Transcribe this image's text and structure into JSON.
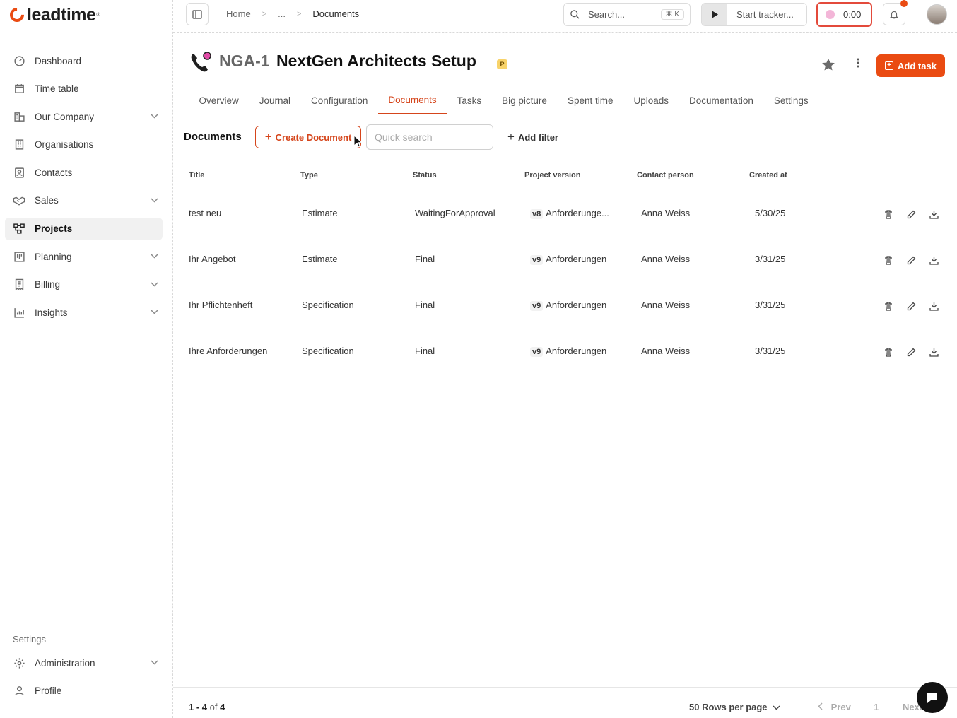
{
  "brand": {
    "name": "leadtime",
    "mark": "®",
    "accent": "#ea4b12"
  },
  "sidebar": {
    "items": [
      {
        "label": "Dashboard",
        "icon": "dashboard-icon",
        "expandable": false
      },
      {
        "label": "Time table",
        "icon": "calendar-icon",
        "expandable": false
      },
      {
        "label": "Our Company",
        "icon": "company-icon",
        "expandable": true
      },
      {
        "label": "Organisations",
        "icon": "building-icon",
        "expandable": false
      },
      {
        "label": "Contacts",
        "icon": "contact-card-icon",
        "expandable": false
      },
      {
        "label": "Sales",
        "icon": "handshake-icon",
        "expandable": true
      },
      {
        "label": "Projects",
        "icon": "projects-icon",
        "expandable": false,
        "active": true
      },
      {
        "label": "Planning",
        "icon": "planning-icon",
        "expandable": true
      },
      {
        "label": "Billing",
        "icon": "billing-icon",
        "expandable": true
      },
      {
        "label": "Insights",
        "icon": "chart-icon",
        "expandable": true
      }
    ],
    "settings_label": "Settings",
    "bottom_items": [
      {
        "label": "Administration",
        "icon": "gear-icon",
        "expandable": true
      },
      {
        "label": "Profile",
        "icon": "user-icon",
        "expandable": false
      }
    ]
  },
  "topbar": {
    "breadcrumb": [
      "Home",
      "...",
      "Documents"
    ],
    "search_label": "Search...",
    "search_shortcut": "⌘ K",
    "tracker_label": "Start tracker...",
    "timer_value": "0:00"
  },
  "project": {
    "key": "NGA-1",
    "name": "NextGen Architects Setup",
    "badge": "P",
    "add_task_label": "Add task"
  },
  "tabs": [
    {
      "label": "Overview"
    },
    {
      "label": "Journal"
    },
    {
      "label": "Configuration"
    },
    {
      "label": "Documents",
      "active": true
    },
    {
      "label": "Tasks"
    },
    {
      "label": "Big picture"
    },
    {
      "label": "Spent time"
    },
    {
      "label": "Uploads"
    },
    {
      "label": "Documentation"
    },
    {
      "label": "Settings"
    }
  ],
  "documents": {
    "title": "Documents",
    "create_label": "Create Document",
    "search_placeholder": "Quick search",
    "add_filter_label": "Add filter",
    "columns": [
      "Title",
      "Type",
      "Status",
      "Project version",
      "Contact person",
      "Created at"
    ],
    "rows": [
      {
        "title": "test neu",
        "type": "Estimate",
        "status": "WaitingForApproval",
        "version": "v8",
        "version_name": "Anforderunge...",
        "contact": "Anna Weiss",
        "created": "5/30/25"
      },
      {
        "title": "Ihr Angebot",
        "type": "Estimate",
        "status": "Final",
        "version": "v9",
        "version_name": "Anforderungen",
        "contact": "Anna Weiss",
        "created": "3/31/25"
      },
      {
        "title": "Ihr Pflichtenheft",
        "type": "Specification",
        "status": "Final",
        "version": "v9",
        "version_name": "Anforderungen",
        "contact": "Anna Weiss",
        "created": "3/31/25"
      },
      {
        "title": "Ihre Anforderungen",
        "type": "Specification",
        "status": "Final",
        "version": "v9",
        "version_name": "Anforderungen",
        "contact": "Anna Weiss",
        "created": "3/31/25"
      }
    ]
  },
  "pagination": {
    "range": "1 - 4",
    "of": "of",
    "total": "4",
    "rows_per_page": "50 Rows per page",
    "prev": "Prev",
    "page": "1",
    "next": "Next"
  }
}
